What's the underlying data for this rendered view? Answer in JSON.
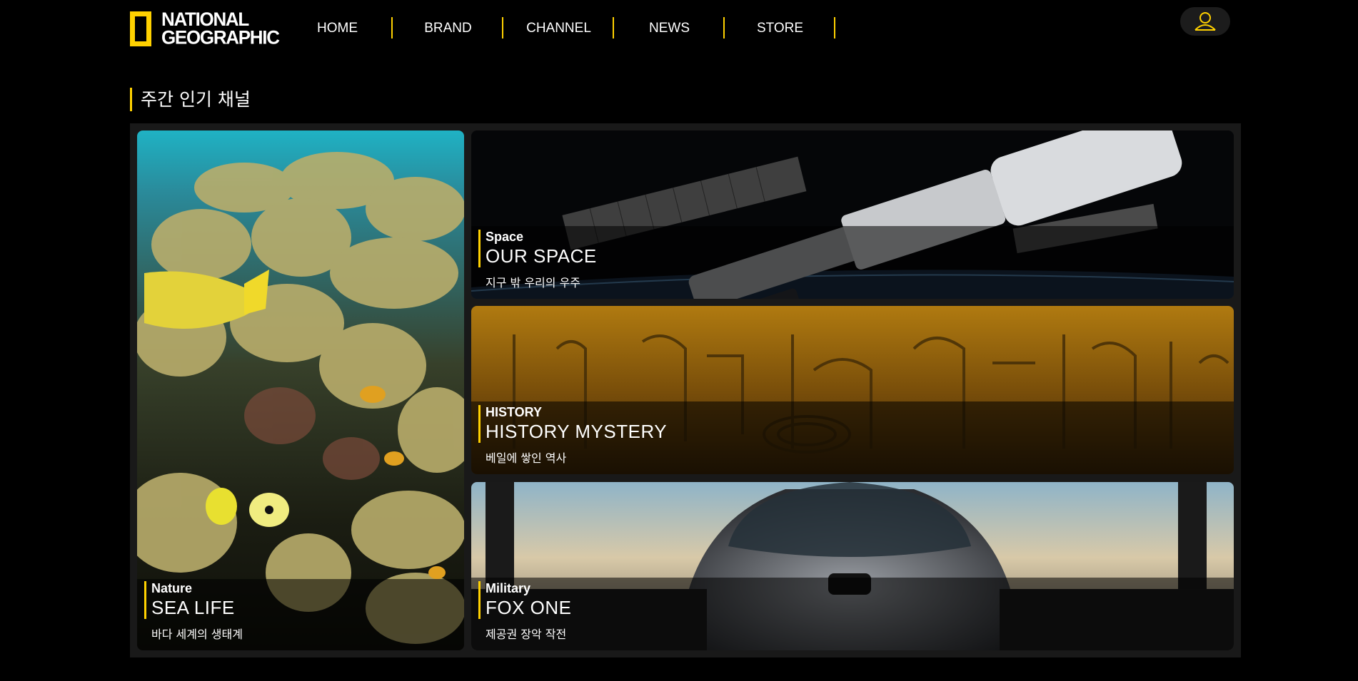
{
  "header": {
    "logo_line1": "NATIONAL",
    "logo_line2": "GEOGRAPHIC",
    "nav": [
      "HOME",
      "BRAND",
      "CHANNEL",
      "NEWS",
      "STORE"
    ],
    "user_icon": "user-icon"
  },
  "section": {
    "title": "주간 인기 채널"
  },
  "cards": {
    "sea": {
      "category": "Nature",
      "title": "SEA LIFE",
      "desc": "바다 세계의 생태계"
    },
    "space": {
      "category": "Space",
      "title": "OUR SPACE",
      "desc": "지구 밖 우리의 우주"
    },
    "history": {
      "category": "HISTORY",
      "title": "HISTORY MYSTERY",
      "desc": "베일에 쌓인 역사"
    },
    "military": {
      "category": "Military",
      "title": "FOX ONE",
      "desc": "제공권 장악 작전"
    }
  },
  "colors": {
    "accent": "#ffd100",
    "background": "#000000",
    "panel": "#191919"
  }
}
